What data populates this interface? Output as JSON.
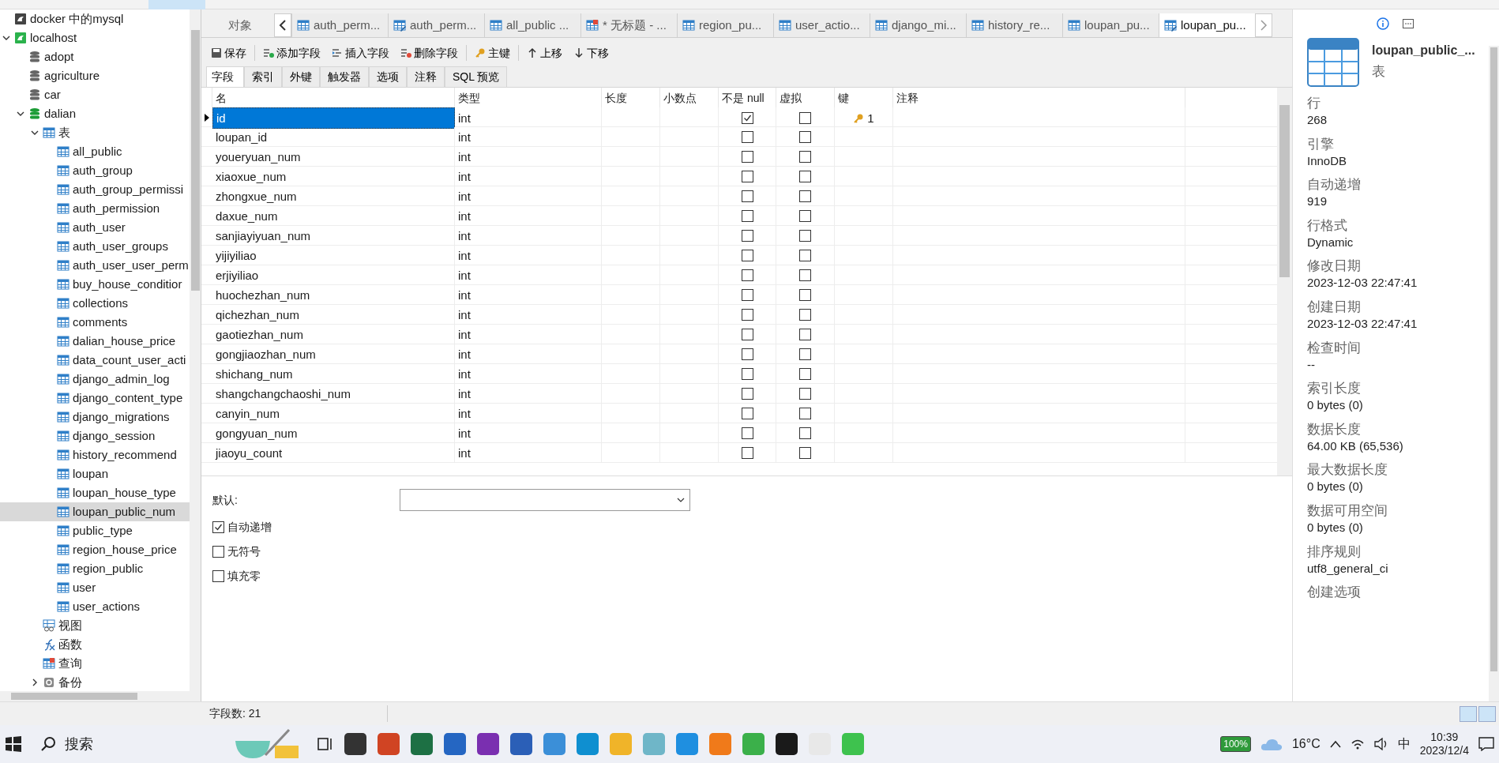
{
  "tree": [
    {
      "label": "docker 中的mysql",
      "kind": "connection",
      "selected": false
    },
    {
      "label": "localhost",
      "kind": "connection-on",
      "expanded": true,
      "selected": false,
      "children": [
        {
          "label": "adopt",
          "kind": "database",
          "selected": false
        },
        {
          "label": "agriculture",
          "kind": "database",
          "selected": false
        },
        {
          "label": "car",
          "kind": "database",
          "selected": false
        },
        {
          "label": "dalian",
          "kind": "database-on",
          "expanded": true,
          "selected": false,
          "children": [
            {
              "label": "表",
              "kind": "tables",
              "expanded": true,
              "selected": false,
              "children": [
                {
                  "label": "all_public",
                  "kind": "table",
                  "selected": false
                },
                {
                  "label": "auth_group",
                  "kind": "table",
                  "selected": false
                },
                {
                  "label": "auth_group_permissi",
                  "kind": "table",
                  "selected": false
                },
                {
                  "label": "auth_permission",
                  "kind": "table",
                  "selected": false
                },
                {
                  "label": "auth_user",
                  "kind": "table",
                  "selected": false
                },
                {
                  "label": "auth_user_groups",
                  "kind": "table",
                  "selected": false
                },
                {
                  "label": "auth_user_user_perm",
                  "kind": "table",
                  "selected": false
                },
                {
                  "label": "buy_house_conditior",
                  "kind": "table",
                  "selected": false
                },
                {
                  "label": "collections",
                  "kind": "table",
                  "selected": false
                },
                {
                  "label": "comments",
                  "kind": "table",
                  "selected": false
                },
                {
                  "label": "dalian_house_price",
                  "kind": "table",
                  "selected": false
                },
                {
                  "label": "data_count_user_acti",
                  "kind": "table",
                  "selected": false
                },
                {
                  "label": "django_admin_log",
                  "kind": "table",
                  "selected": false
                },
                {
                  "label": "django_content_type",
                  "kind": "table",
                  "selected": false
                },
                {
                  "label": "django_migrations",
                  "kind": "table",
                  "selected": false
                },
                {
                  "label": "django_session",
                  "kind": "table",
                  "selected": false
                },
                {
                  "label": "history_recommend",
                  "kind": "table",
                  "selected": false
                },
                {
                  "label": "loupan",
                  "kind": "table",
                  "selected": false
                },
                {
                  "label": "loupan_house_type",
                  "kind": "table",
                  "selected": false
                },
                {
                  "label": "loupan_public_num",
                  "kind": "table",
                  "selected": true
                },
                {
                  "label": "public_type",
                  "kind": "table",
                  "selected": false
                },
                {
                  "label": "region_house_price",
                  "kind": "table",
                  "selected": false
                },
                {
                  "label": "region_public",
                  "kind": "table",
                  "selected": false
                },
                {
                  "label": "user",
                  "kind": "table",
                  "selected": false
                },
                {
                  "label": "user_actions",
                  "kind": "table",
                  "selected": false
                }
              ]
            },
            {
              "label": "视图",
              "kind": "view",
              "selected": false
            },
            {
              "label": "函数",
              "kind": "function",
              "selected": false
            },
            {
              "label": "查询",
              "kind": "query",
              "selected": false
            },
            {
              "label": "备份",
              "kind": "backup",
              "expanded": false,
              "selected": false
            }
          ]
        }
      ]
    }
  ],
  "object_tab": {
    "label": "对象"
  },
  "tabs": [
    {
      "label": "auth_perm...",
      "kind": "table",
      "selected": false
    },
    {
      "label": "auth_perm...",
      "kind": "design",
      "selected": false
    },
    {
      "label": "all_public ...",
      "kind": "table",
      "selected": false
    },
    {
      "label": "* 无标题 - ...",
      "kind": "query",
      "selected": false
    },
    {
      "label": "region_pu...",
      "kind": "table",
      "selected": false
    },
    {
      "label": "user_actio...",
      "kind": "table",
      "selected": false
    },
    {
      "label": "django_mi...",
      "kind": "table",
      "selected": false
    },
    {
      "label": "history_re...",
      "kind": "table",
      "selected": false
    },
    {
      "label": "loupan_pu...",
      "kind": "table",
      "selected": false
    },
    {
      "label": "loupan_pu...",
      "kind": "design",
      "selected": true
    }
  ],
  "toolbar": [
    {
      "label": "保存",
      "kind": "save"
    },
    {
      "label": "添加字段",
      "kind": "add"
    },
    {
      "label": "插入字段",
      "kind": "insert"
    },
    {
      "label": "删除字段",
      "kind": "delete"
    },
    {
      "label": "主键",
      "kind": "key"
    },
    {
      "label": "上移",
      "kind": "up"
    },
    {
      "label": "下移",
      "kind": "down"
    }
  ],
  "subtabs": [
    {
      "label": "字段",
      "selected": true
    },
    {
      "label": "索引",
      "selected": false
    },
    {
      "label": "外键",
      "selected": false
    },
    {
      "label": "触发器",
      "selected": false
    },
    {
      "label": "选项",
      "selected": false
    },
    {
      "label": "注释",
      "selected": false
    },
    {
      "label": "SQL 预览",
      "selected": false
    }
  ],
  "table": {
    "columns": [
      "名",
      "类型",
      "长度",
      "小数点",
      "不是 null",
      "虚拟",
      "键",
      "注释"
    ],
    "rows": [
      {
        "name": "id",
        "type": "int",
        "not_null": true,
        "virtual": false,
        "key": "1",
        "selected": true
      },
      {
        "name": "loupan_id",
        "type": "int",
        "not_null": false,
        "virtual": false,
        "selected": false
      },
      {
        "name": "youeryuan_num",
        "type": "int",
        "not_null": false,
        "virtual": false,
        "selected": false
      },
      {
        "name": "xiaoxue_num",
        "type": "int",
        "not_null": false,
        "virtual": false,
        "selected": false
      },
      {
        "name": "zhongxue_num",
        "type": "int",
        "not_null": false,
        "virtual": false,
        "selected": false
      },
      {
        "name": "daxue_num",
        "type": "int",
        "not_null": false,
        "virtual": false,
        "selected": false
      },
      {
        "name": "sanjiayiyuan_num",
        "type": "int",
        "not_null": false,
        "virtual": false,
        "selected": false
      },
      {
        "name": "yijiyiliao",
        "type": "int",
        "not_null": false,
        "virtual": false,
        "selected": false
      },
      {
        "name": "erjiyiliao",
        "type": "int",
        "not_null": false,
        "virtual": false,
        "selected": false
      },
      {
        "name": "huochezhan_num",
        "type": "int",
        "not_null": false,
        "virtual": false,
        "selected": false
      },
      {
        "name": "qichezhan_num",
        "type": "int",
        "not_null": false,
        "virtual": false,
        "selected": false
      },
      {
        "name": "gaotiezhan_num",
        "type": "int",
        "not_null": false,
        "virtual": false,
        "selected": false
      },
      {
        "name": "gongjiaozhan_num",
        "type": "int",
        "not_null": false,
        "virtual": false,
        "selected": false
      },
      {
        "name": "shichang_num",
        "type": "int",
        "not_null": false,
        "virtual": false,
        "selected": false
      },
      {
        "name": "shangchangchaoshi_num",
        "type": "int",
        "not_null": false,
        "virtual": false,
        "selected": false
      },
      {
        "name": "canyin_num",
        "type": "int",
        "not_null": false,
        "virtual": false,
        "selected": false
      },
      {
        "name": "gongyuan_num",
        "type": "int",
        "not_null": false,
        "virtual": false,
        "selected": false
      },
      {
        "name": "jiaoyu_count",
        "type": "int",
        "not_null": false,
        "virtual": false,
        "selected": false
      }
    ]
  },
  "field_options": {
    "default_label": "默认:",
    "options": [
      {
        "label": "自动递增",
        "checked": true
      },
      {
        "label": "无符号",
        "checked": false
      },
      {
        "label": "填充零",
        "checked": false
      }
    ]
  },
  "status_bar": "字段数: 21",
  "info": {
    "title": "loupan_public_...",
    "subtitle": "表",
    "properties": [
      {
        "label": "行",
        "value": "268"
      },
      {
        "label": "引擎",
        "value": "InnoDB"
      },
      {
        "label": "自动递增",
        "value": "919"
      },
      {
        "label": "行格式",
        "value": "Dynamic"
      },
      {
        "label": "修改日期",
        "value": "2023-12-03 22:47:41"
      },
      {
        "label": "创建日期",
        "value": "2023-12-03 22:47:41"
      },
      {
        "label": "检查时间",
        "value": "--"
      },
      {
        "label": "索引长度",
        "value": "0 bytes (0)"
      },
      {
        "label": "数据长度",
        "value": "64.00 KB (65,536)"
      },
      {
        "label": "最大数据长度",
        "value": "0 bytes (0)"
      },
      {
        "label": "数据可用空间",
        "value": "0 bytes (0)"
      },
      {
        "label": "排序规则",
        "value": "utf8_general_ci"
      },
      {
        "label": "创建选项"
      }
    ]
  },
  "taskbar": {
    "search": {
      "placeholder": "搜索"
    },
    "battery": "100%",
    "weather": "16°C",
    "ime": "中",
    "time": "10:39",
    "date": "2023/12/4"
  }
}
